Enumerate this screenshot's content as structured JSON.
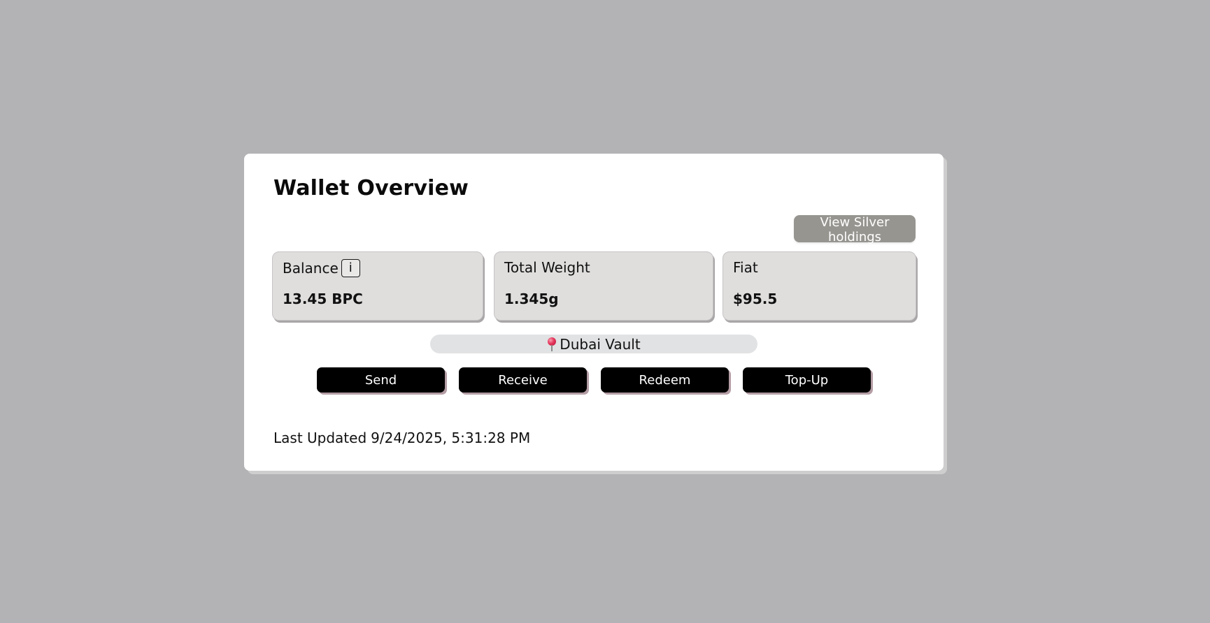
{
  "wallet": {
    "title": "Wallet Overview",
    "view_holdings_label": "View Silver holdings",
    "stats": {
      "balance": {
        "label": "Balance",
        "info_label": "i",
        "value": "13.45 BPC"
      },
      "weight": {
        "label": "Total Weight",
        "value": "1.345g"
      },
      "fiat": {
        "label": "Fiat",
        "value": "$95.5"
      }
    },
    "location": {
      "icon": "pushpin-icon",
      "label": "Dubai Vault"
    },
    "actions": {
      "send": "Send",
      "receive": "Receive",
      "redeem": "Redeem",
      "topup": "Top-Up"
    },
    "last_updated": {
      "label": "Last Updated",
      "value": "9/24/2025, 5:31:28 PM"
    }
  },
  "colors": {
    "page_background": "#b3b2b4",
    "card_background": "#ffffff",
    "stat_background": "#dfdedd",
    "holdings_button": "#979590",
    "action_button": "#000000",
    "location_pill": "#e1e2e4"
  }
}
